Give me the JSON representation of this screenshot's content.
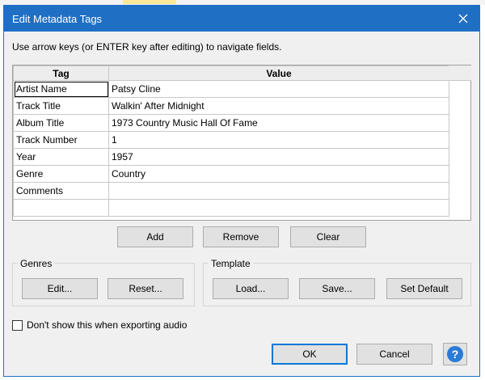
{
  "dialog": {
    "title": "Edit Metadata Tags",
    "instructions": "Use arrow keys (or ENTER key after editing) to navigate fields."
  },
  "grid": {
    "columns": [
      "Tag",
      "Value"
    ],
    "rows": [
      {
        "tag": "Artist Name",
        "value": "Patsy Cline"
      },
      {
        "tag": "Track Title",
        "value": "Walkin' After Midnight"
      },
      {
        "tag": "Album Title",
        "value": "1973 Country Music Hall Of Fame"
      },
      {
        "tag": "Track Number",
        "value": "1"
      },
      {
        "tag": "Year",
        "value": "1957"
      },
      {
        "tag": "Genre",
        "value": "Country"
      },
      {
        "tag": "Comments",
        "value": ""
      },
      {
        "tag": "",
        "value": ""
      }
    ]
  },
  "row_actions": {
    "add": "Add",
    "remove": "Remove",
    "clear": "Clear"
  },
  "genres": {
    "label": "Genres",
    "edit": "Edit...",
    "reset": "Reset..."
  },
  "template": {
    "label": "Template",
    "load": "Load...",
    "save": "Save...",
    "set_default": "Set Default"
  },
  "options": {
    "dont_show_label": "Don't show this when exporting audio",
    "dont_show_checked": false
  },
  "footer": {
    "ok": "OK",
    "cancel": "Cancel",
    "help_glyph": "?"
  },
  "colors": {
    "titlebar": "#1f6fc5",
    "default_button_border": "#0078d7",
    "help_icon": "#2b7bd6"
  }
}
